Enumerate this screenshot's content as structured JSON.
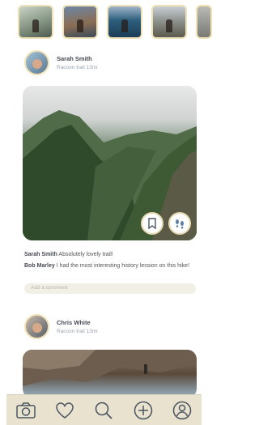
{
  "stories": [
    "story-1",
    "story-2",
    "story-3",
    "story-4",
    "story-5"
  ],
  "posts": [
    {
      "user": "Sarah Smith",
      "trail": "Racoon trail 13mi",
      "comments": [
        {
          "user": "Sarah Smith",
          "text": "Absolutely lovely trail!"
        },
        {
          "user": "Bob Marley",
          "text": "I had the most interesting history lession on this hike!"
        }
      ],
      "add_comment_placeholder": "Add a comment"
    },
    {
      "user": "Chris White",
      "trail": "Racoon trail 13mi"
    }
  ],
  "icons": {
    "bookmark": "bookmark-icon",
    "footprints": "footprints-icon",
    "camera": "camera-icon",
    "heart": "heart-icon",
    "search": "search-icon",
    "plus": "plus-icon",
    "profile": "profile-icon"
  },
  "colors": {
    "accent_border": "#f0e2b6",
    "nav_bg": "#e9e2cf",
    "icon_stroke": "#4a5560"
  }
}
